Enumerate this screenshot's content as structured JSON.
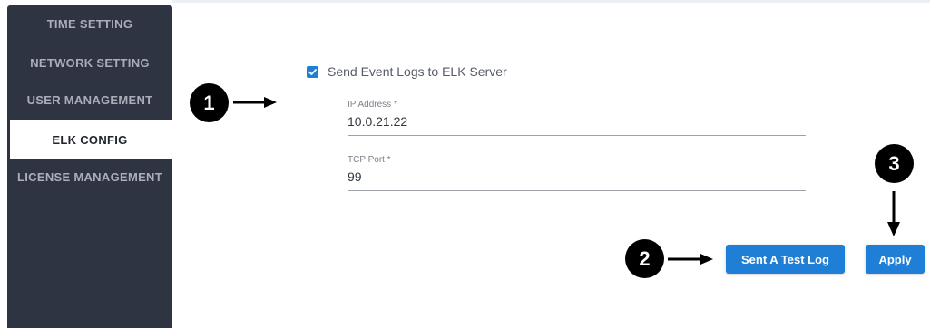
{
  "sidebar": {
    "items": [
      {
        "label": "TIME SETTING",
        "active": false
      },
      {
        "label": "NETWORK SETTING",
        "active": false
      },
      {
        "label": "USER MANAGEMENT",
        "active": false
      },
      {
        "label": "ELK CONFIG",
        "active": true
      },
      {
        "label": "LICENSE MANAGEMENT",
        "active": false
      }
    ]
  },
  "form": {
    "send_logs_checkbox": {
      "checked": true,
      "label": "Send Event Logs to ELK Server"
    },
    "ip_address": {
      "label": "IP Address *",
      "value": "10.0.21.22"
    },
    "tcp_port": {
      "label": "TCP Port *",
      "value": "99"
    }
  },
  "actions": {
    "test_log_label": "Sent A Test Log",
    "apply_label": "Apply"
  },
  "annotations": {
    "step1": "1",
    "step2": "2",
    "step3": "3"
  },
  "colors": {
    "sidebar_bg": "#2f3442",
    "accent": "#1f7fd6"
  }
}
